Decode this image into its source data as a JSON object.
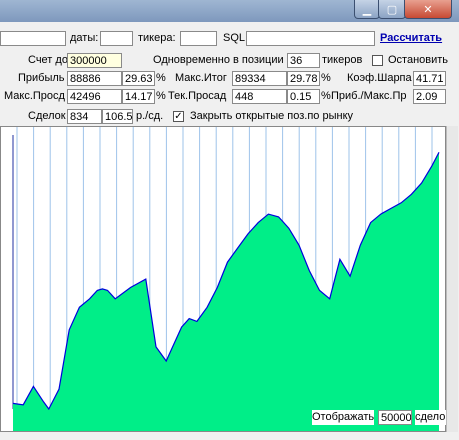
{
  "window": {
    "minimize": "▁",
    "maximize": "▢",
    "close": "✕"
  },
  "toolbar": {
    "dates_label": "даты:",
    "dates_value": "",
    "tickers_label": "тикера:",
    "tickers_value": "",
    "sql_label": "SQL",
    "sql_value": "",
    "calc_link": "Рассчитать"
  },
  "stats": {
    "account_label": "Счет до",
    "account_value": "300000",
    "concurrent_label": "Одновременно в позиции",
    "concurrent_value": "36",
    "tickers_unit": "тикеров",
    "stop_label": "Остановить",
    "stop_checked": false,
    "profit_label": "Прибыль",
    "profit_value": "88886",
    "profit_pct": "29.63",
    "pct1": "%",
    "max_total_label": "Макс.Итог",
    "max_total_value": "89334",
    "max_total_pct": "29.78",
    "pct2": "%",
    "sharpe_label": "Коэф.Шарпа",
    "sharpe_value": "41.71",
    "max_dd_label": "Макс.Просд",
    "max_dd_value": "42496",
    "max_dd_pct": "14.17",
    "pct3": "%",
    "cur_dd_label": "Тек.Просад",
    "cur_dd_value": "448",
    "cur_dd_pct": "0.15",
    "pct4": "%",
    "pm_label": "Приб./Макс.Пр",
    "pm_value": "2.09",
    "deals_label": "Сделок",
    "deals_value": "834",
    "per_day_value": "106.5",
    "per_day_unit": "р./сд.",
    "close_open_checked": true,
    "close_open_mark": "✓",
    "close_open_label": "Закрыть открытые поз.по рынку"
  },
  "footer": {
    "show_label": "Отображать",
    "show_value": "50000",
    "show_unit": "сделок"
  },
  "chart_data": {
    "type": "area",
    "title": "",
    "xlabel": "",
    "ylabel": "",
    "fill_color": "#00ee88",
    "line_color": "#0000dd",
    "grid": true,
    "x": [
      0,
      20,
      40,
      60,
      70,
      90,
      110,
      130,
      150,
      165,
      175,
      185,
      200,
      230,
      260,
      280,
      300,
      315,
      330,
      345,
      360,
      380,
      400,
      420,
      440,
      460,
      480,
      500,
      520,
      540,
      560,
      580,
      600,
      620,
      640,
      660,
      680,
      700,
      720,
      740,
      760,
      780,
      800,
      820,
      834
    ],
    "y": [
      0,
      -500,
      6000,
      500,
      -2000,
      5000,
      26000,
      34000,
      37000,
      40000,
      40500,
      40000,
      37000,
      41000,
      44000,
      20000,
      15000,
      21000,
      27000,
      30000,
      29000,
      34000,
      41000,
      50000,
      55000,
      60000,
      64000,
      67000,
      66000,
      62000,
      56000,
      47000,
      40000,
      37000,
      51000,
      45000,
      56000,
      64000,
      67000,
      69000,
      71000,
      74000,
      78000,
      84000,
      88886
    ],
    "ylim": [
      -2000,
      95000
    ],
    "xlim": [
      0,
      834
    ]
  }
}
